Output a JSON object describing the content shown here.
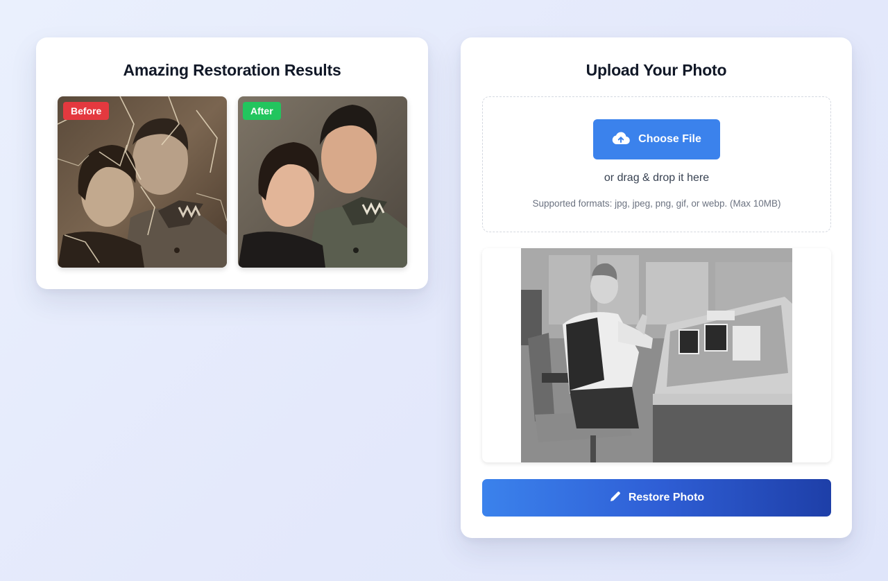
{
  "results": {
    "title": "Amazing Restoration Results",
    "before_label": "Before",
    "after_label": "After"
  },
  "upload": {
    "title": "Upload Your Photo",
    "choose_file_label": "Choose File",
    "drag_text": "or drag & drop it here",
    "formats_text": "Supported formats: jpg, jpeg, png, gif, or webp. (Max 10MB)",
    "restore_label": "Restore Photo"
  },
  "icons": {
    "upload": "cloud-upload-icon",
    "restore": "pencil-icon"
  },
  "colors": {
    "primary": "#3b82ec",
    "primary_dark": "#1e3fa8",
    "before_badge": "#e4393f",
    "after_badge": "#22c55e"
  }
}
